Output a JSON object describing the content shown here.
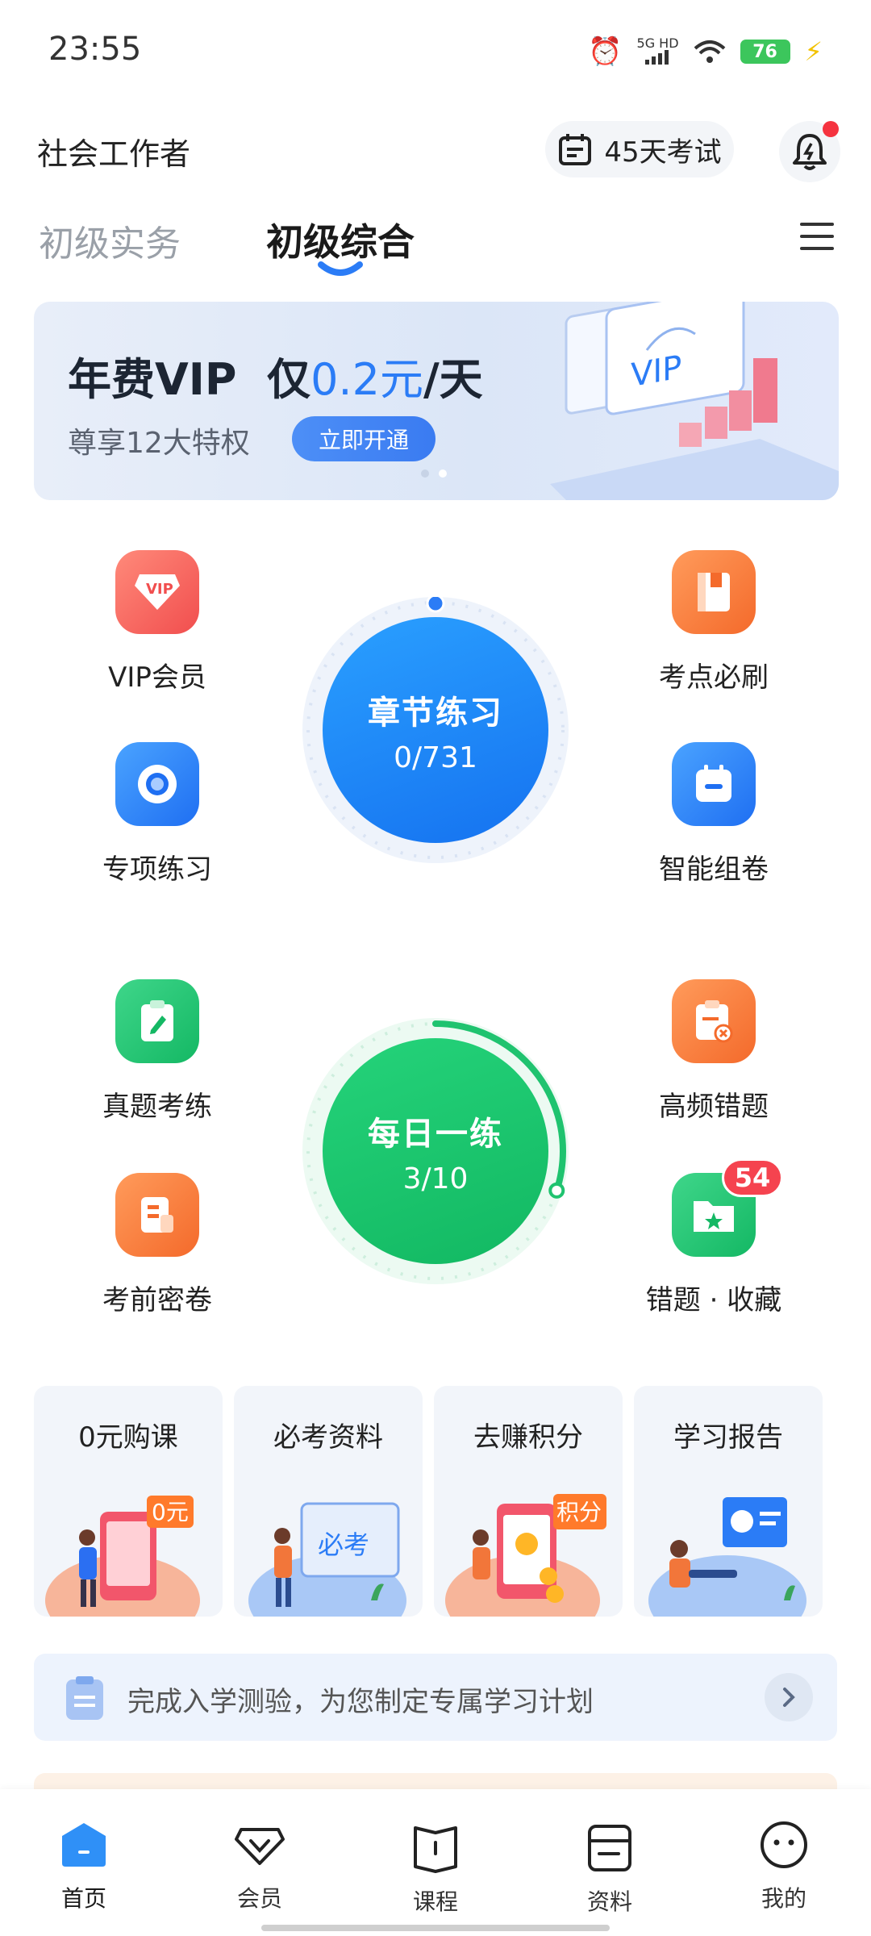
{
  "status_bar": {
    "time": "23:55",
    "network": "5G HD",
    "battery": "76"
  },
  "header": {
    "title": "社会工作者",
    "exam_countdown": "45天考试"
  },
  "tabs": [
    {
      "label": "初级实务",
      "active": false
    },
    {
      "label": "初级综合",
      "active": true
    }
  ],
  "banner": {
    "title_prefix": "年费VIP  仅",
    "price": "0.2元",
    "title_suffix": "/天",
    "subtitle": "尊享12大特权",
    "button": "立即开通",
    "art_text": "VIP"
  },
  "features": {
    "vip": "VIP会员",
    "kaodian": "考点必刷",
    "zhuanxiang": "专项练习",
    "zujuan": "智能组卷",
    "zhenti": "真题考练",
    "gaopin": "高频错题",
    "miya": "考前密卷",
    "cuoti": "错题 · 收藏",
    "cuoti_badge": "54"
  },
  "chapter": {
    "title": "章节练习",
    "progress": "0/731",
    "done": 0,
    "total": 731
  },
  "daily": {
    "title": "每日一练",
    "progress": "3/10",
    "done": 3,
    "total": 10
  },
  "cards": [
    {
      "title": "0元购课",
      "tag": "0元"
    },
    {
      "title": "必考资料",
      "tag": "必考"
    },
    {
      "title": "去赚积分",
      "tag": "积分"
    },
    {
      "title": "学习报告",
      "tag": ""
    }
  ],
  "tip": {
    "text": "完成入学测验，为您制定专属学习计划"
  },
  "bottom_nav": [
    {
      "label": "首页",
      "icon": "home-icon",
      "active": true
    },
    {
      "label": "会员",
      "icon": "vip-diamond-icon",
      "active": false
    },
    {
      "label": "课程",
      "icon": "book-icon",
      "active": false
    },
    {
      "label": "资料",
      "icon": "document-icon",
      "active": false
    },
    {
      "label": "我的",
      "icon": "profile-icon",
      "active": false
    }
  ],
  "colors": {
    "brand_blue": "#2b7cf6",
    "green": "#1fc36f",
    "red_badge": "#f5434f"
  }
}
